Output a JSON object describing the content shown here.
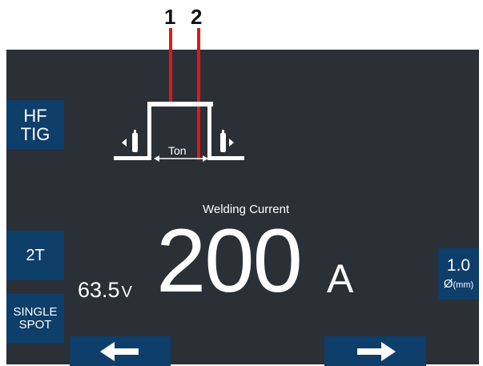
{
  "callouts": [
    "1",
    "2"
  ],
  "diagram": {
    "ton_label": "Ton"
  },
  "left_buttons": {
    "mode": [
      "HF",
      "TIG"
    ],
    "trigger": "2T",
    "spot": [
      "SINGLE",
      "SPOT"
    ]
  },
  "main": {
    "title": "Welding Current",
    "value": "200",
    "unit": "A",
    "voltage": "63.5",
    "voltage_unit": "V"
  },
  "right_button": {
    "value": "1.0",
    "unit_symbol": "Ø",
    "unit": "(mm)"
  },
  "nav": {
    "prev": "left-arrow-icon",
    "next": "right-arrow-icon"
  },
  "colors": {
    "screen_bg": "#2b2f36",
    "button_bg": "#0e3e6a",
    "pointer": "#e3161b",
    "text": "#ffffff"
  }
}
